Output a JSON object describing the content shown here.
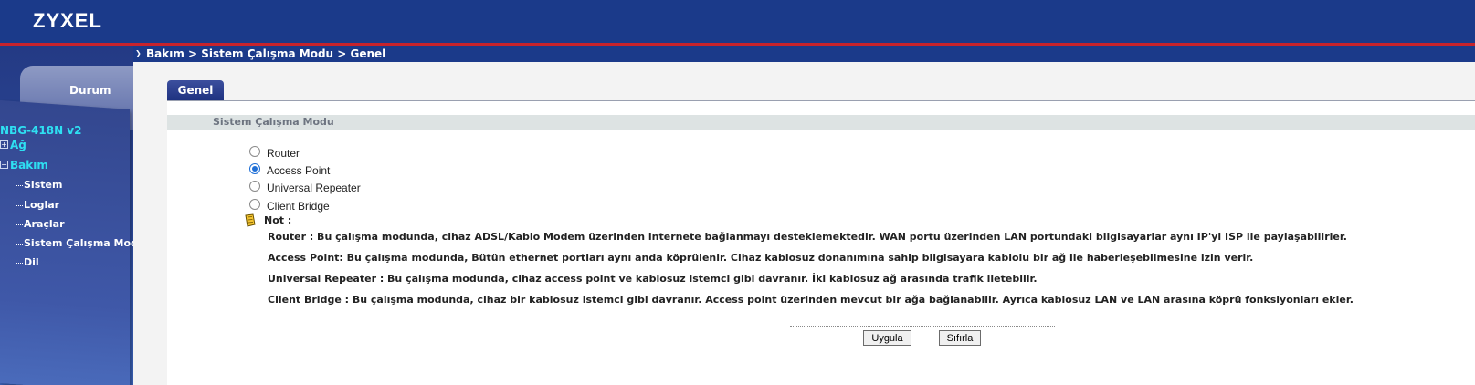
{
  "header": {
    "brand": "ZYXEL"
  },
  "sidebar": {
    "status_tab": "Durum",
    "device": "NBG-418N v2",
    "tree": [
      {
        "label": "Ağ",
        "expander": "+"
      },
      {
        "label": "Bakım",
        "expander": "−"
      }
    ],
    "subitems": [
      "Sistem",
      "Loglar",
      "Araçlar",
      "Sistem Çalışma Modu",
      "Dil"
    ]
  },
  "breadcrumb": "Bakım > Sistem Çalışma Modu > Genel",
  "tabs": [
    {
      "label": "Genel",
      "active": true
    }
  ],
  "section": {
    "title": "Sistem Çalışma Modu"
  },
  "modes": [
    {
      "label": "Router",
      "checked": false
    },
    {
      "label": "Access Point",
      "checked": true
    },
    {
      "label": "Universal Repeater",
      "checked": false
    },
    {
      "label": "Client Bridge",
      "checked": false
    }
  ],
  "note": {
    "label": "Not :",
    "lines": [
      "Router : Bu çalışma modunda, cihaz ADSL/Kablo Modem üzerinden internete bağlanmayı desteklemektedir. WAN portu üzerinden LAN portundaki bilgisayarlar aynı IP'yi ISP ile paylaşabilirler.",
      "Access Point: Bu çalışma modunda, Bütün ethernet portları aynı anda köprülenir. Cihaz kablosuz donanımına sahip bilgisayara kablolu bir ağ ile haberleşebilmesine izin verir.",
      "Universal Repeater : Bu çalışma modunda, cihaz access point ve kablosuz istemci gibi davranır. İki kablosuz ağ arasında trafik iletebilir.",
      "Client Bridge : Bu çalışma modunda, cihaz bir kablosuz istemci gibi davranır. Access point üzerinden mevcut bir ağa bağlanabilir. Ayrıca kablosuz LAN ve LAN arasına köprü fonksiyonları ekler."
    ]
  },
  "buttons": {
    "apply": "Uygula",
    "reset": "Sıfırla"
  },
  "colors": {
    "header_blue": "#1b3a8a",
    "accent_red": "#c8232c",
    "tree_cyan": "#2ee0f2",
    "radio_blue": "#1f6fd6"
  }
}
